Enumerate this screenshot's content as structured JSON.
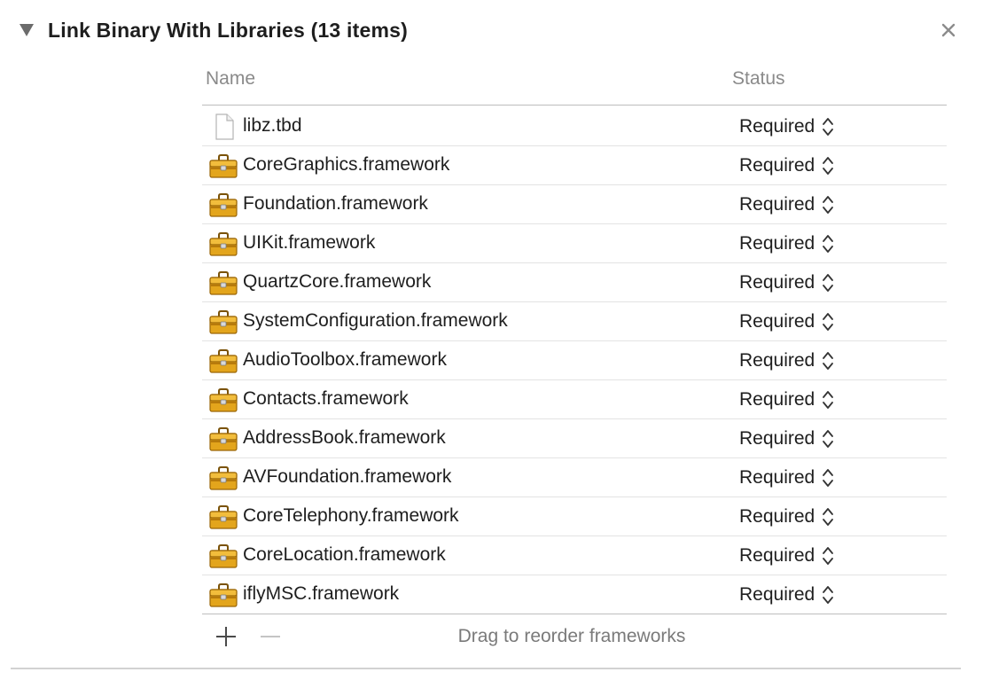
{
  "section": {
    "title": "Link Binary With Libraries (13 items)",
    "disclosure_icon": "disclosure-triangle-expanded",
    "close_icon": "close-x-icon"
  },
  "table": {
    "columns": {
      "name": "Name",
      "status": "Status"
    },
    "rows": [
      {
        "icon": "file-icon",
        "name": "libz.tbd",
        "status": "Required"
      },
      {
        "icon": "toolbox-icon",
        "name": "CoreGraphics.framework",
        "status": "Required"
      },
      {
        "icon": "toolbox-icon",
        "name": "Foundation.framework",
        "status": "Required"
      },
      {
        "icon": "toolbox-icon",
        "name": "UIKit.framework",
        "status": "Required"
      },
      {
        "icon": "toolbox-icon",
        "name": "QuartzCore.framework",
        "status": "Required"
      },
      {
        "icon": "toolbox-icon",
        "name": "SystemConfiguration.framework",
        "status": "Required"
      },
      {
        "icon": "toolbox-icon",
        "name": "AudioToolbox.framework",
        "status": "Required"
      },
      {
        "icon": "toolbox-icon",
        "name": "Contacts.framework",
        "status": "Required"
      },
      {
        "icon": "toolbox-icon",
        "name": "AddressBook.framework",
        "status": "Required"
      },
      {
        "icon": "toolbox-icon",
        "name": "AVFoundation.framework",
        "status": "Required"
      },
      {
        "icon": "toolbox-icon",
        "name": "CoreTelephony.framework",
        "status": "Required"
      },
      {
        "icon": "toolbox-icon",
        "name": "CoreLocation.framework",
        "status": "Required"
      },
      {
        "icon": "toolbox-icon",
        "name": "iflyMSC.framework",
        "status": "Required"
      }
    ]
  },
  "footer": {
    "add_icon": "plus-icon",
    "remove_icon": "minus-icon",
    "hint": "Drag to reorder frameworks"
  },
  "colors": {
    "toolbox_body": "#e0a21a",
    "toolbox_dark": "#a8700a",
    "header_text": "#8a8a8a",
    "divider": "#d2d2d2"
  }
}
